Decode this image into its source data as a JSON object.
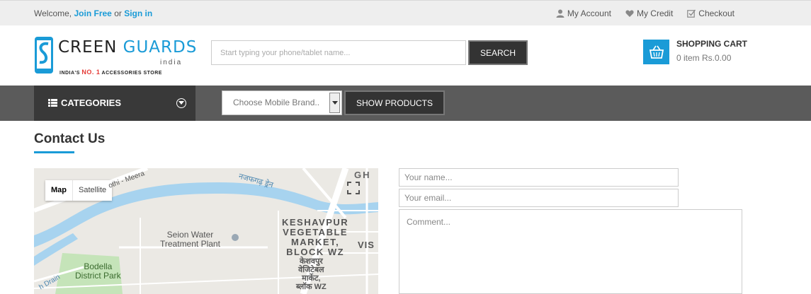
{
  "topbar": {
    "welcome": "Welcome,",
    "join": "Join Free",
    "or": "or",
    "signin": "Sign in",
    "links": [
      {
        "icon": "user-icon",
        "label": "My Account"
      },
      {
        "icon": "heart-icon",
        "label": "My Credit"
      },
      {
        "icon": "checkbox-icon",
        "label": "Checkout"
      }
    ]
  },
  "header": {
    "logo": {
      "word1": "S",
      "word2": "CREEN",
      "word3": "GUARDS",
      "sub": "india",
      "tag_pre": "INDIA'S",
      "tag_no1": "NO. 1",
      "tag_post": "ACCESSORIES STORE"
    },
    "search": {
      "placeholder": "Start typing your phone/tablet name...",
      "button": "SEARCH"
    },
    "cart": {
      "title": "SHOPPING CART",
      "summary": "0 item Rs.0.00",
      "icon": "basket-icon"
    }
  },
  "nav": {
    "categories": "CATEGORIES",
    "brand_select": "Choose Mobile Brand..",
    "show_products": "SHOW PRODUCTS"
  },
  "main": {
    "title": "Contact Us",
    "map": {
      "tab_map": "Map",
      "tab_satellite": "Satellite",
      "labels": {
        "gh": "GH",
        "road": "othi - Meera",
        "canal": "नजफगढ़ ड्रेन",
        "water": "Seion Water\nTreatment Plant",
        "market": "KESHAVPUR\nVEGETABLE\nMARKET,\nBLOCK WZ",
        "market_hi": "केशवपुर\nवेजिटेबल\nमार्केट,\nब्लॉक WZ",
        "vis": "VIS",
        "park": "Bodella\nDistrict Park",
        "drain": "h Drain"
      }
    },
    "form": {
      "name_placeholder": "Your name...",
      "email_placeholder": "Your email...",
      "comment_placeholder": "Comment..."
    }
  },
  "colors": {
    "accent": "#1a9bd7",
    "nav_bg": "#5b5b5b",
    "categories_bg": "#393939",
    "button_bg": "#333333"
  }
}
